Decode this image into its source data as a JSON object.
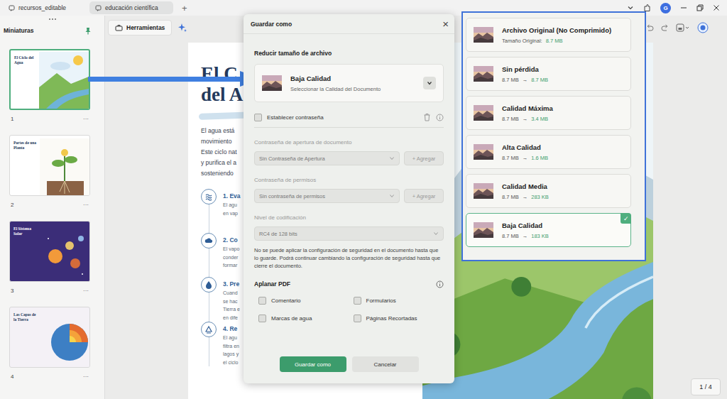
{
  "browser": {
    "tabs": [
      {
        "label": "recursos_editable",
        "selected": false
      },
      {
        "label": "educación científica",
        "selected": true
      }
    ],
    "new_tab": "+",
    "avatar": "G"
  },
  "sidebar": {
    "title": "Miniaturas",
    "pages": [
      {
        "number": "1",
        "title": "El Ciclo del Agua",
        "menu": "···",
        "selected": true
      },
      {
        "number": "2",
        "title": "Partes de una Planta",
        "menu": "···",
        "selected": false
      },
      {
        "number": "3",
        "title": "El Sistema Solar",
        "menu": "···",
        "selected": false
      },
      {
        "number": "4",
        "title": "Las Capas de la Tierra",
        "menu": "···",
        "selected": false
      }
    ]
  },
  "toolbar": {
    "tools_label": "Herramientas"
  },
  "document": {
    "title_lines": [
      "El C",
      "del A"
    ],
    "intro_lines": [
      "El agua está",
      "movimiento",
      "Este ciclo nat",
      "y purifica el a",
      "sosteniendo"
    ],
    "steps": [
      {
        "title": "1. Eva",
        "lines": [
          "El agu",
          "en vap"
        ]
      },
      {
        "title": "2. Co",
        "lines": [
          "El vapo",
          "conder",
          "formar"
        ]
      },
      {
        "title": "3. Pre",
        "lines": [
          "Cuand",
          "se hac",
          "Tierra e",
          "en dife"
        ]
      },
      {
        "title": "4. Re",
        "lines": [
          "El agu",
          "filtra en",
          "lagos y",
          "el ciclo"
        ]
      }
    ]
  },
  "page_indicator": "1 / 4",
  "dialog": {
    "title": "Guardar como",
    "close": "×",
    "reduce_label": "Reducir tamaño de archivo",
    "quality": {
      "name": "Baja Calidad",
      "hint": "Seleccionar la Calidad del Documento",
      "expanded": true
    },
    "password": {
      "label": "Establecer contraseña",
      "checked": false
    },
    "open_password": {
      "label": "Contraseña de apertura de documento",
      "value": "Sin Contraseña de Apertura",
      "add": "+ Agregar",
      "disabled": true
    },
    "permissions_password": {
      "label": "Contraseña de permisos",
      "value": "Sin contraseña de permisos",
      "add": "+ Agregar",
      "disabled": true
    },
    "encryption": {
      "label": "Nivel de codificación",
      "value": "RC4 de 128 bits",
      "disabled": true
    },
    "note": "No se puede aplicar la configuración de seguridad en el documento hasta que lo guarde. Podrá continuar cambiando la configuración de seguridad hasta que cierre el documento.",
    "flatten": {
      "label": "Aplanar PDF",
      "options": [
        {
          "label": "Comentario",
          "checked": false
        },
        {
          "label": "Formularios",
          "checked": false
        },
        {
          "label": "Marcas de agua",
          "checked": false
        },
        {
          "label": "Páginas Recortadas",
          "checked": false
        }
      ]
    },
    "buttons": [
      {
        "label": "Guardar como",
        "primary": true
      },
      {
        "label": "Cancelar",
        "primary": false
      }
    ]
  },
  "quality_panel": {
    "check": "✓",
    "options": [
      {
        "kind": "original",
        "name": "Archivo Original (No Comprimido)",
        "label": "Tamaño Original:",
        "size": "8.7 MB",
        "selected": false
      },
      {
        "kind": "compressed",
        "name": "Sin pérdida",
        "from": "8.7 MB",
        "arrow": "→",
        "to": "8.7 MB",
        "selected": false
      },
      {
        "kind": "compressed",
        "name": "Calidad Máxima",
        "from": "8.7 MB",
        "arrow": "→",
        "to": "3.4 MB",
        "selected": false
      },
      {
        "kind": "compressed",
        "name": "Alta Calidad",
        "from": "8.7 MB",
        "arrow": "→",
        "to": "1.6 MB",
        "selected": false
      },
      {
        "kind": "compressed",
        "name": "Calidad Media",
        "from": "8.7 MB",
        "arrow": "→",
        "to": "283 KB",
        "selected": false
      },
      {
        "kind": "compressed",
        "name": "Baja Calidad",
        "from": "8.7 MB",
        "arrow": "→",
        "to": "183 KB",
        "selected": true
      }
    ]
  }
}
